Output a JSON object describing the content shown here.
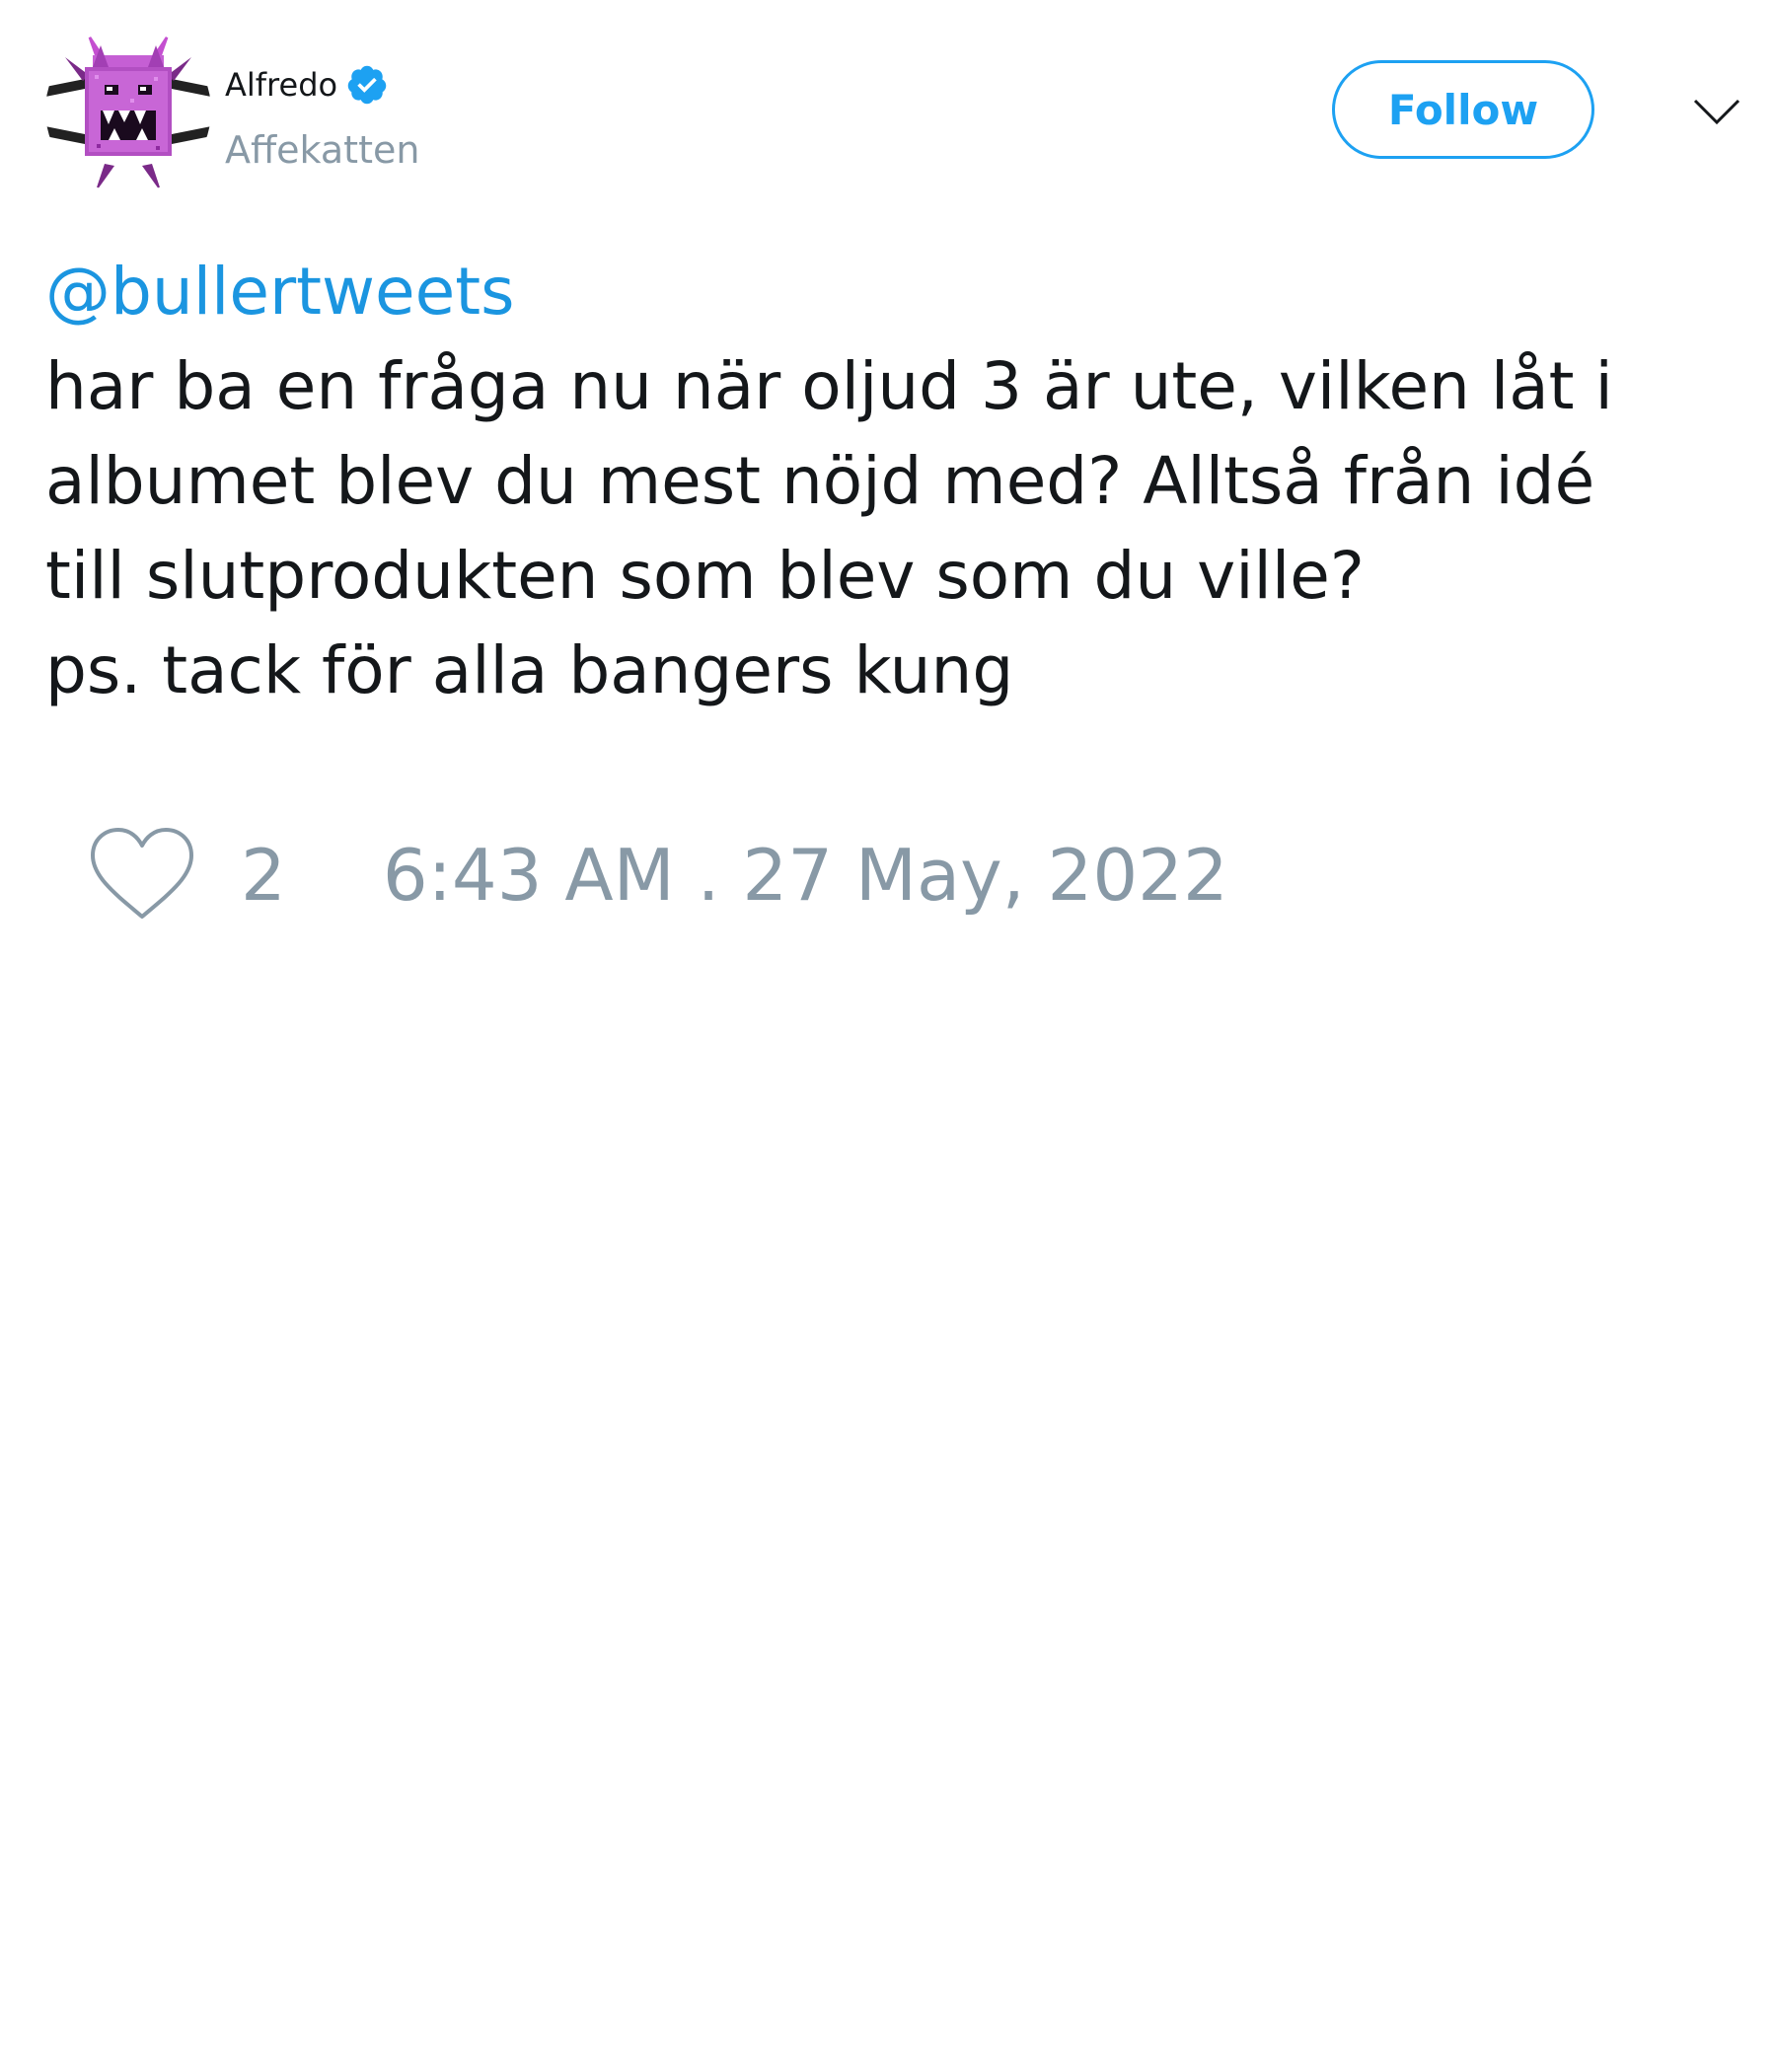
{
  "author": {
    "display_name": "Alfredo",
    "username": "Affekatten",
    "verified": true,
    "avatar_icon": "purple-pixel-monster-avatar"
  },
  "actions": {
    "follow_label": "Follow",
    "menu_icon": "chevron-down-icon"
  },
  "tweet": {
    "mention": "@bullertweets",
    "lines": [
      "har ba en fråga nu när oljud 3 är ute, vilken låt i",
      "albumet blev du mest nöjd med? Alltså från idé",
      "till slutprodukten som blev som du ville?",
      "ps. tack för alla bangers kung"
    ]
  },
  "footer": {
    "like_icon": "heart-icon",
    "like_count": "2",
    "timestamp": "6:43 AM . 27 May, 2022"
  },
  "colors": {
    "accent": "#1da1f2",
    "mention": "#1b95e0",
    "text": "#14171a",
    "secondary": "#8899a6",
    "avatar_purple": "#b24fc2"
  }
}
